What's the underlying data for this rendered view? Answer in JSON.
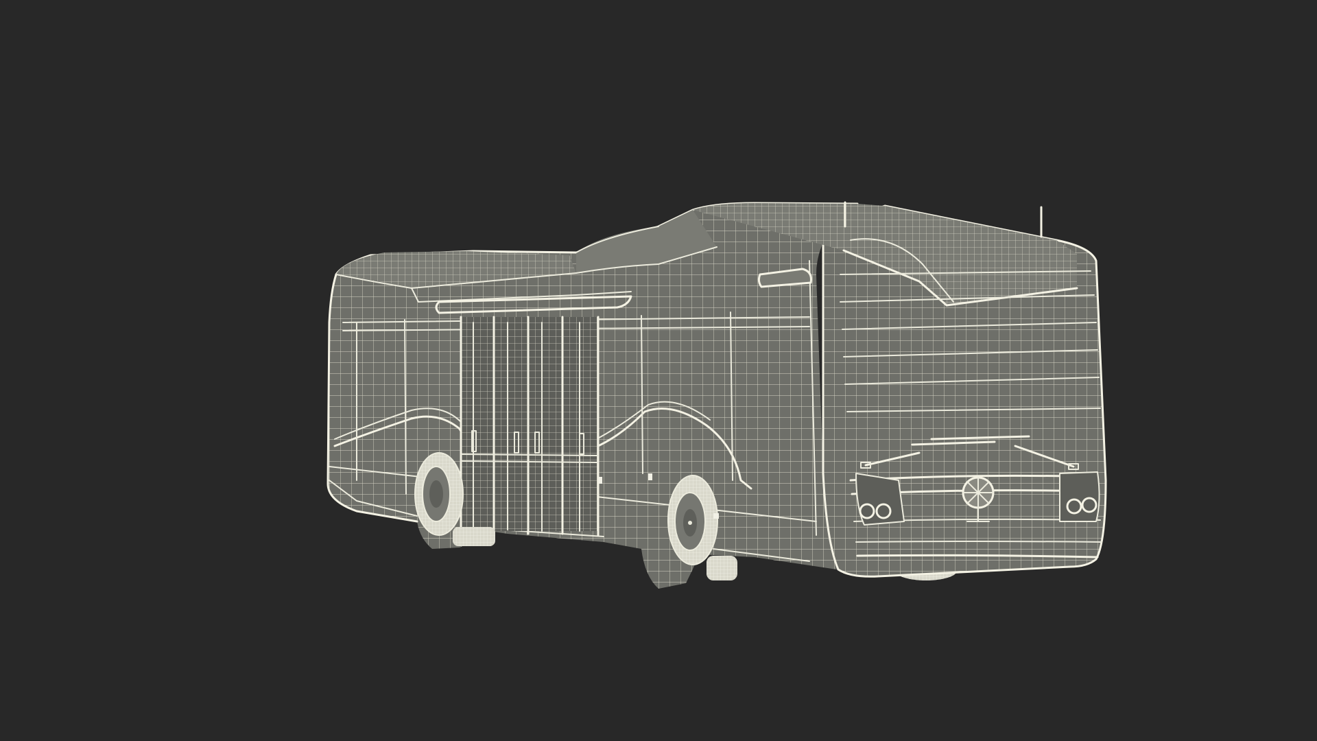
{
  "scene": {
    "background_color": "#282828",
    "model_fill_color": "#6e6f69",
    "wire_color": "#ecebdd"
  }
}
